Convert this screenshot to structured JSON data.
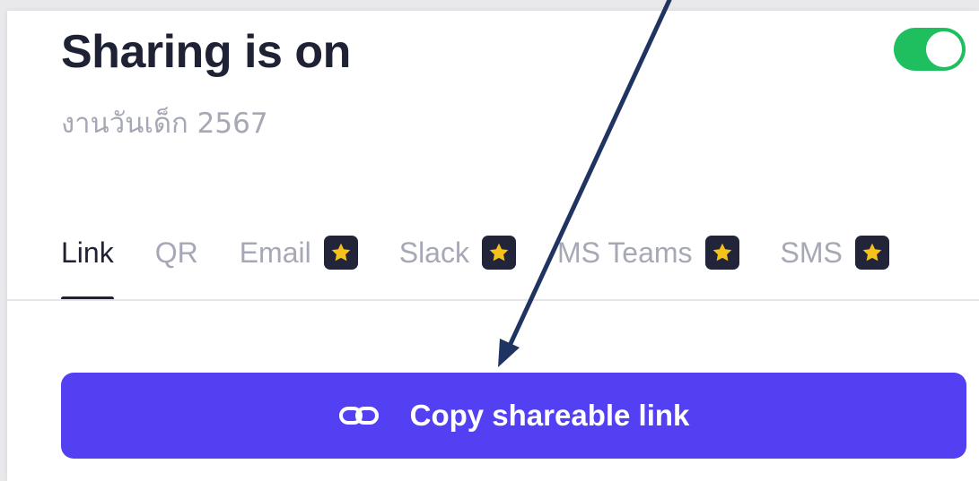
{
  "header": {
    "title": "Sharing is on",
    "subtitle": "งานวันเด็ก 2567",
    "toggle_on": true
  },
  "tabs": [
    {
      "label": "Link",
      "active": true,
      "premium": false
    },
    {
      "label": "QR",
      "active": false,
      "premium": false
    },
    {
      "label": "Email",
      "active": false,
      "premium": true
    },
    {
      "label": "Slack",
      "active": false,
      "premium": true
    },
    {
      "label": "MS Teams",
      "active": false,
      "premium": true
    },
    {
      "label": "SMS",
      "active": false,
      "premium": true
    }
  ],
  "actions": {
    "copy_label": "Copy shareable link"
  },
  "icons": {
    "premium": "star-icon",
    "copy": "link-icon"
  },
  "colors": {
    "primary": "#5240f2",
    "toggle": "#1fbf5f",
    "heading": "#1f2235",
    "muted": "#a6a8b5",
    "star": "#f5c21b",
    "annotation_arrow": "#1f3461"
  }
}
